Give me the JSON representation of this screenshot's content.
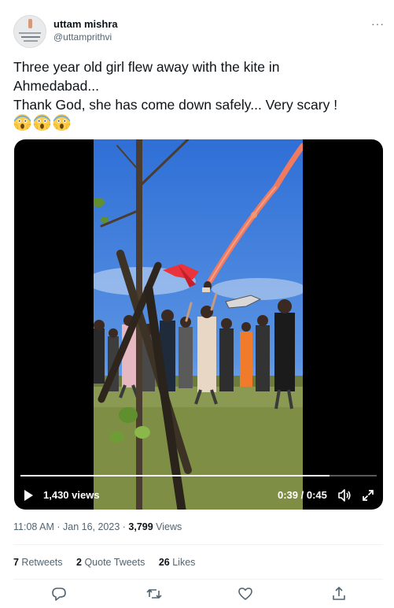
{
  "user": {
    "name": "uttam mishra",
    "handle": "@uttamprithvi"
  },
  "more_icon": "more-icon",
  "tweet": {
    "lines": [
      "Three year old girl flew away with the kite in",
      "Ahmedabad...",
      "Thank God, she has come down safely... Very scary !"
    ],
    "emoji": [
      "face-screaming-in-fear",
      "face-screaming-in-fear",
      "face-screaming-in-fear"
    ]
  },
  "video": {
    "views": "1,430 views",
    "time": "0:39 / 0:45",
    "progress": 0.867,
    "play_icon": "play-icon",
    "volume_icon": "volume-icon",
    "fullscreen_icon": "fullscreen-icon"
  },
  "meta": {
    "time_date": "11:08 AM · Jan 16, 2023 · ",
    "views_count": "3,799",
    "views_label": " Views"
  },
  "stats": {
    "retweets_count": "7",
    "retweets_label": " Retweets",
    "quotes_count": "2",
    "quotes_label": " Quote Tweets",
    "likes_count": "26",
    "likes_label": " Likes"
  },
  "actions": [
    "reply-icon",
    "retweet-icon",
    "like-icon",
    "share-icon"
  ],
  "colors": {
    "text": "#0f1419",
    "secondary": "#536471",
    "divider": "#eff3f4",
    "video_bg": "#000000"
  }
}
